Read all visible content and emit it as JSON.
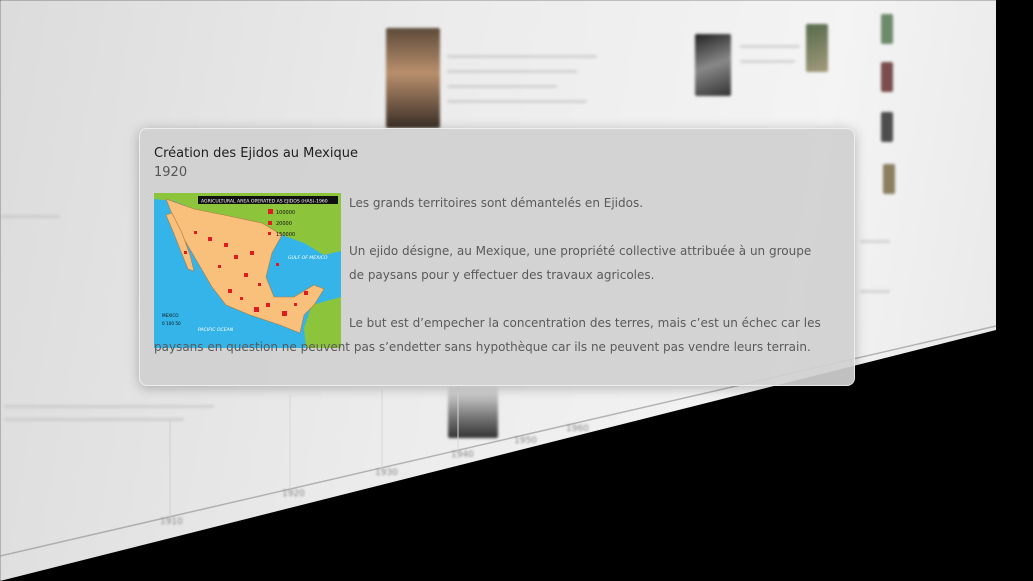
{
  "popup": {
    "title": "Création des Ejidos au Mexique",
    "year": "1920",
    "paragraphs": [
      "Les grands territoires sont démantelés en Ejidos.",
      "Un ejido désigne, au Mexique, une propriété collective attribuée à un groupe de paysans pour y effectuer des travaux agricoles.",
      "Le but est d’empecher la concentration des terres, mais c’est un échec car les paysans en question ne peuvent pas s’endetter sans hypothèque car ils ne peuvent pas vendre leurs terrain."
    ],
    "map": {
      "header": "AGRICULTURAL AREA OPERATED AS EJIDOS (HAS)-1960",
      "legend": [
        "100000",
        "20000",
        "150000"
      ],
      "gulf_label": "GULF OF MEXICO",
      "ocean_label": "PACIFIC OCEAN",
      "country_label": "MEXICO",
      "scale_label": "0 100 50",
      "colors": {
        "land": "#f8c07a",
        "sea": "#34b4e8",
        "neighbor": "#8cc43c",
        "marker": "#e11b22"
      }
    }
  },
  "timeline": {
    "tick_labels": [
      "1910",
      "1920",
      "1930",
      "1940",
      "1950",
      "1960"
    ]
  }
}
